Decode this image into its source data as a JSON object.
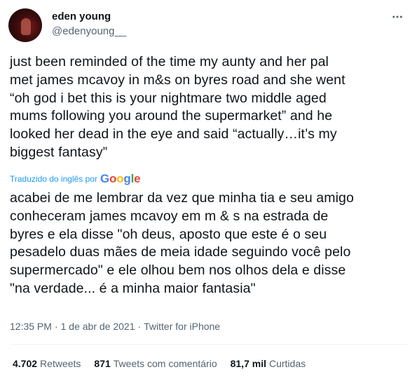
{
  "author": {
    "name": "eden young",
    "handle": "@edenyoung__",
    "avatar_icon": "profile-avatar"
  },
  "menu_icon": "more-horizontal-icon",
  "tweet": {
    "text_lines": [
      "just been reminded of the time my aunty and her pal",
      "met james mcavoy in m&s on byres road and she went",
      "“oh god i bet this is your nightmare two middle aged",
      "mums following you around the supermarket” and he",
      "looked her dead in the eye and said “actually…it’s my",
      "biggest fantasy”"
    ],
    "translated_label": "Traduzido do inglês por",
    "translated_by": "Google",
    "translation_lines": [
      "acabei de me lembrar da vez que minha tia e seu amigo",
      "conheceram james mcavoy em m & s na estrada de",
      "byres e ela disse \"oh deus, aposto que este é o seu",
      "pesadelo duas mães de meia idade seguindo você pelo",
      "supermercado\" e ele olhou bem nos olhos dela e disse",
      "\"na verdade... é a minha maior fantasia\""
    ]
  },
  "meta": {
    "time": "12:35 PM",
    "date": "1 de abr de 2021",
    "separator": "·",
    "source": "Twitter for iPhone"
  },
  "stats": {
    "retweets_count": "4.702",
    "retweets_label": "Retweets",
    "quotes_count": "871",
    "quotes_label": "Tweets com comentário",
    "likes_count": "81,7 mil",
    "likes_label": "Curtidas"
  },
  "colors": {
    "link": "#1d9bf0",
    "secondary_text": "#536471",
    "primary_text": "#0f1419",
    "divider": "#eff3f4"
  }
}
